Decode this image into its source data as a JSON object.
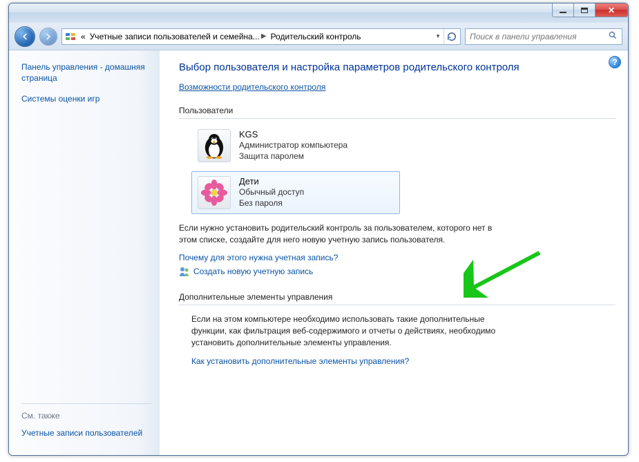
{
  "titlebar": {
    "minimize": "Свернуть",
    "maximize": "Развернуть",
    "close": "Закрыть"
  },
  "nav": {
    "back": "Назад",
    "forward": "Вперёд"
  },
  "breadcrumb": {
    "segment1": "Учетные записи пользователей и семейна...",
    "segment2": "Родительский контроль"
  },
  "search": {
    "placeholder": "Поиск в панели управления"
  },
  "sidebar": {
    "home_link": "Панель управления - домашняя страница",
    "rating_link": "Системы оценки игр",
    "see_also_label": "См. также",
    "user_accounts_link": "Учетные записи пользователей"
  },
  "content": {
    "heading": "Выбор пользователя и настройка параметров родительского контроля",
    "capabilities_link": "Возможности родительского контроля",
    "users_label": "Пользователи",
    "users": [
      {
        "name": "KGS",
        "role": "Администратор компьютера",
        "status": "Защита паролем",
        "avatar": "penguin",
        "selected": false
      },
      {
        "name": "Дети",
        "role": "Обычный доступ",
        "status": "Без пароля",
        "avatar": "flower",
        "selected": true
      }
    ],
    "note1": "Если нужно установить родительский контроль за пользователем, которого нет в этом списке, создайте для него новую учетную запись пользователя.",
    "why_link": "Почему для этого нужна учетная запись?",
    "create_link": "Создать новую учетную запись",
    "extras_label": "Дополнительные элементы управления",
    "note2": "Если на этом компьютере необходимо использовать такие дополнительные функции, как фильтрация веб-содержимого и отчеты о действиях, необходимо установить дополнительные элементы управления.",
    "extras_link": "Как установить дополнительные элементы управления?"
  },
  "help_tooltip": "Справка"
}
